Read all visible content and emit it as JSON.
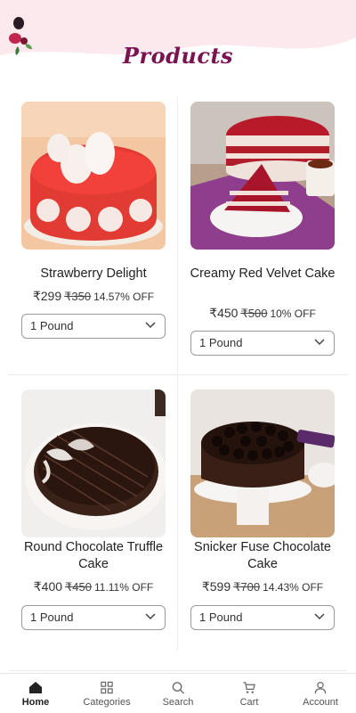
{
  "header": {
    "title": "Products"
  },
  "products": [
    {
      "name": "Strawberry Delight",
      "price": "₹299",
      "mrp": "₹350",
      "discount": "14.57% OFF",
      "weight": "1 Pound"
    },
    {
      "name": "Creamy Red Velvet Cake",
      "price": "₹450",
      "mrp": "₹500",
      "discount": "10% OFF",
      "weight": "1 Pound"
    },
    {
      "name": "Round Chocolate Truffle Cake",
      "price": "₹400",
      "mrp": "₹450",
      "discount": "11.11% OFF",
      "weight": "1 Pound"
    },
    {
      "name": "Snicker Fuse Chocolate Cake",
      "price": "₹599",
      "mrp": "₹700",
      "discount": "14.43% OFF",
      "weight": "1 Pound"
    }
  ],
  "nav": {
    "items": [
      {
        "label": "Home",
        "icon": "home-icon"
      },
      {
        "label": "Categories",
        "icon": "grid-icon"
      },
      {
        "label": "Search",
        "icon": "search-icon"
      },
      {
        "label": "Cart",
        "icon": "cart-icon"
      },
      {
        "label": "Account",
        "icon": "user-icon"
      }
    ],
    "active": "Home"
  },
  "colors": {
    "accent": "#7a1350",
    "header_bg": "#fbe9ee",
    "border": "#9a9a9a"
  }
}
